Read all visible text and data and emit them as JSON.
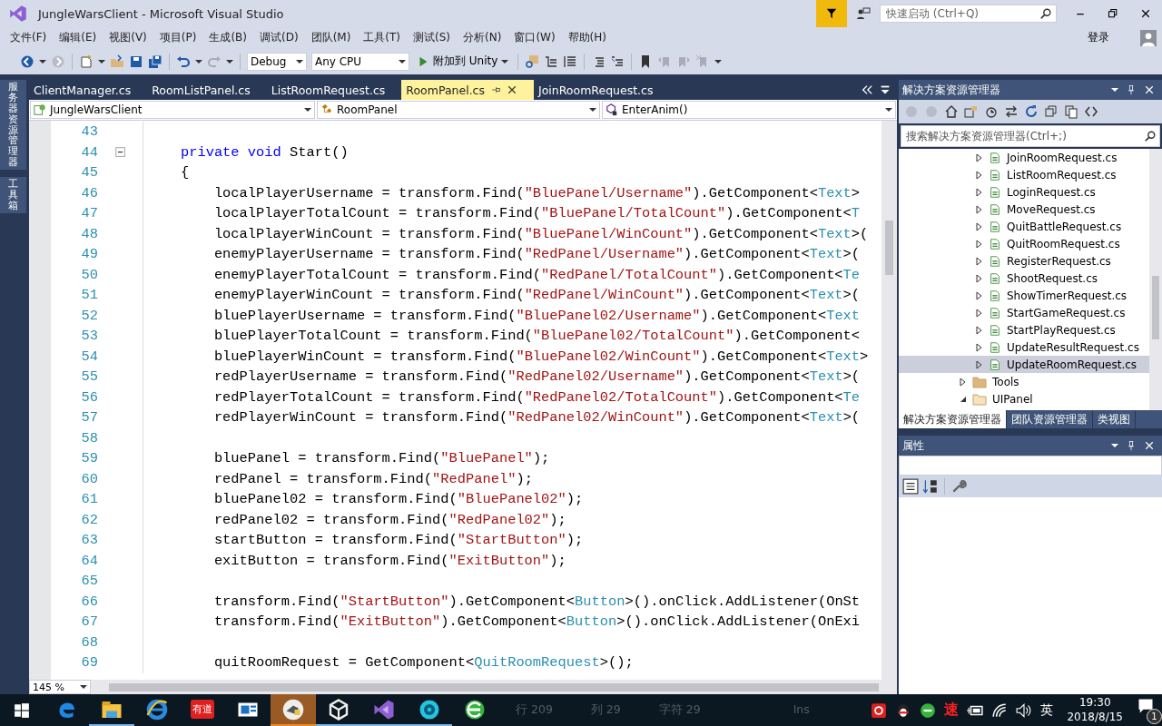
{
  "window": {
    "title": "JungleWarsClient - Microsoft Visual Studio",
    "quick_launch": {
      "placeholder": "快速启动 (Ctrl+Q)"
    }
  },
  "menu": [
    "文件(F)",
    "编辑(E)",
    "视图(V)",
    "项目(P)",
    "生成(B)",
    "调试(D)",
    "团队(M)",
    "工具(T)",
    "测试(S)",
    "分析(N)",
    "窗口(W)",
    "帮助(H)"
  ],
  "sign_in": "登录",
  "toolbar": {
    "configuration": "Debug",
    "platform": "Any CPU",
    "run": "附加到 Unity"
  },
  "side_tabs": [
    "服务器资源管理器",
    "工具箱"
  ],
  "editor_tabs": [
    {
      "label": "ClientManager.cs",
      "selected": false
    },
    {
      "label": "RoomListPanel.cs",
      "selected": false
    },
    {
      "label": "ListRoomRequest.cs",
      "selected": false
    },
    {
      "label": "RoomPanel.cs",
      "selected": true
    },
    {
      "label": "JoinRoomRequest.cs",
      "selected": false
    }
  ],
  "nav_bar": {
    "project": "JungleWarsClient",
    "type": "RoomPanel",
    "member": "EnterAnim()"
  },
  "code_lines": [
    {
      "number": "43"
    },
    {
      "number": "44",
      "collapsible": true,
      "tokens": [
        {
          "kind": "keyword",
          "text": "    private void"
        },
        {
          "kind": "plain",
          "text": " Start()"
        }
      ]
    },
    {
      "number": "45",
      "tokens": [
        {
          "kind": "plain",
          "text": "    {"
        }
      ]
    },
    {
      "number": "46",
      "tokens": [
        {
          "kind": "plain",
          "text": "        localPlayerUsername = transform.Find("
        },
        {
          "kind": "string",
          "text": "\"BluePanel/Username\""
        },
        {
          "kind": "plain",
          "text": ").GetComponent<"
        },
        {
          "kind": "type",
          "text": "Text"
        },
        {
          "kind": "plain",
          "text": ">"
        }
      ]
    },
    {
      "number": "47",
      "tokens": [
        {
          "kind": "plain",
          "text": "        localPlayerTotalCount = transform.Find("
        },
        {
          "kind": "string",
          "text": "\"BluePanel/TotalCount\""
        },
        {
          "kind": "plain",
          "text": ").GetComponent<"
        },
        {
          "kind": "type",
          "text": "T"
        }
      ]
    },
    {
      "number": "48",
      "tokens": [
        {
          "kind": "plain",
          "text": "        localPlayerWinCount = transform.Find("
        },
        {
          "kind": "string",
          "text": "\"BluePanel/WinCount\""
        },
        {
          "kind": "plain",
          "text": ").GetComponent<"
        },
        {
          "kind": "type",
          "text": "Text"
        },
        {
          "kind": "plain",
          "text": ">("
        }
      ]
    },
    {
      "number": "49",
      "tokens": [
        {
          "kind": "plain",
          "text": "        enemyPlayerUsername = transform.Find("
        },
        {
          "kind": "string",
          "text": "\"RedPanel/Username\""
        },
        {
          "kind": "plain",
          "text": ").GetComponent<"
        },
        {
          "kind": "type",
          "text": "Text"
        },
        {
          "kind": "plain",
          "text": ">("
        }
      ]
    },
    {
      "number": "50",
      "tokens": [
        {
          "kind": "plain",
          "text": "        enemyPlayerTotalCount = transform.Find("
        },
        {
          "kind": "string",
          "text": "\"RedPanel/TotalCount\""
        },
        {
          "kind": "plain",
          "text": ").GetComponent<"
        },
        {
          "kind": "type",
          "text": "Te"
        }
      ]
    },
    {
      "number": "51",
      "tokens": [
        {
          "kind": "plain",
          "text": "        enemyPlayerWinCount = transform.Find("
        },
        {
          "kind": "string",
          "text": "\"RedPanel/WinCount\""
        },
        {
          "kind": "plain",
          "text": ").GetComponent<"
        },
        {
          "kind": "type",
          "text": "Text"
        },
        {
          "kind": "plain",
          "text": ">("
        }
      ]
    },
    {
      "number": "52",
      "tokens": [
        {
          "kind": "plain",
          "text": "        bluePlayerUsername = transform.Find("
        },
        {
          "kind": "string",
          "text": "\"BluePanel02/Username\""
        },
        {
          "kind": "plain",
          "text": ").GetComponent<"
        },
        {
          "kind": "type",
          "text": "Text"
        }
      ]
    },
    {
      "number": "53",
      "tokens": [
        {
          "kind": "plain",
          "text": "        bluePlayerTotalCount = transform.Find("
        },
        {
          "kind": "string",
          "text": "\"BluePanel02/TotalCount\""
        },
        {
          "kind": "plain",
          "text": ").GetComponent<"
        }
      ]
    },
    {
      "number": "54",
      "tokens": [
        {
          "kind": "plain",
          "text": "        bluePlayerWinCount = transform.Find("
        },
        {
          "kind": "string",
          "text": "\"BluePanel02/WinCount\""
        },
        {
          "kind": "plain",
          "text": ").GetComponent<"
        },
        {
          "kind": "type",
          "text": "Text"
        },
        {
          "kind": "plain",
          "text": ">"
        }
      ]
    },
    {
      "number": "55",
      "tokens": [
        {
          "kind": "plain",
          "text": "        redPlayerUsername = transform.Find("
        },
        {
          "kind": "string",
          "text": "\"RedPanel02/Username\""
        },
        {
          "kind": "plain",
          "text": ").GetComponent<"
        },
        {
          "kind": "type",
          "text": "Text"
        },
        {
          "kind": "plain",
          "text": ">("
        }
      ]
    },
    {
      "number": "56",
      "tokens": [
        {
          "kind": "plain",
          "text": "        redPlayerTotalCount = transform.Find("
        },
        {
          "kind": "string",
          "text": "\"RedPanel02/TotalCount\""
        },
        {
          "kind": "plain",
          "text": ").GetComponent<"
        },
        {
          "kind": "type",
          "text": "Te"
        }
      ]
    },
    {
      "number": "57",
      "tokens": [
        {
          "kind": "plain",
          "text": "        redPlayerWinCount = transform.Find("
        },
        {
          "kind": "string",
          "text": "\"RedPanel02/WinCount\""
        },
        {
          "kind": "plain",
          "text": ").GetComponent<"
        },
        {
          "kind": "type",
          "text": "Text"
        },
        {
          "kind": "plain",
          "text": ">("
        }
      ]
    },
    {
      "number": "58"
    },
    {
      "number": "59",
      "tokens": [
        {
          "kind": "plain",
          "text": "        bluePanel = transform.Find("
        },
        {
          "kind": "string",
          "text": "\"BluePanel\""
        },
        {
          "kind": "plain",
          "text": ");"
        }
      ]
    },
    {
      "number": "60",
      "tokens": [
        {
          "kind": "plain",
          "text": "        redPanel = transform.Find("
        },
        {
          "kind": "string",
          "text": "\"RedPanel\""
        },
        {
          "kind": "plain",
          "text": ");"
        }
      ]
    },
    {
      "number": "61",
      "tokens": [
        {
          "kind": "plain",
          "text": "        bluePanel02 = transform.Find("
        },
        {
          "kind": "string",
          "text": "\"BluePanel02\""
        },
        {
          "kind": "plain",
          "text": ");"
        }
      ]
    },
    {
      "number": "62",
      "tokens": [
        {
          "kind": "plain",
          "text": "        redPanel02 = transform.Find("
        },
        {
          "kind": "string",
          "text": "\"RedPanel02\""
        },
        {
          "kind": "plain",
          "text": ");"
        }
      ]
    },
    {
      "number": "63",
      "tokens": [
        {
          "kind": "plain",
          "text": "        startButton = transform.Find("
        },
        {
          "kind": "string",
          "text": "\"StartButton\""
        },
        {
          "kind": "plain",
          "text": ");"
        }
      ]
    },
    {
      "number": "64",
      "tokens": [
        {
          "kind": "plain",
          "text": "        exitButton = transform.Find("
        },
        {
          "kind": "string",
          "text": "\"ExitButton\""
        },
        {
          "kind": "plain",
          "text": ");"
        }
      ]
    },
    {
      "number": "65"
    },
    {
      "number": "66",
      "tokens": [
        {
          "kind": "plain",
          "text": "        transform.Find("
        },
        {
          "kind": "string",
          "text": "\"StartButton\""
        },
        {
          "kind": "plain",
          "text": ").GetComponent<"
        },
        {
          "kind": "type",
          "text": "Button"
        },
        {
          "kind": "plain",
          "text": ">().onClick.AddListener(OnSt"
        }
      ]
    },
    {
      "number": "67",
      "tokens": [
        {
          "kind": "plain",
          "text": "        transform.Find("
        },
        {
          "kind": "string",
          "text": "\"ExitButton\""
        },
        {
          "kind": "plain",
          "text": ").GetComponent<"
        },
        {
          "kind": "type",
          "text": "Button"
        },
        {
          "kind": "plain",
          "text": ">().onClick.AddListener(OnExi"
        }
      ]
    },
    {
      "number": "68"
    },
    {
      "number": "69",
      "tokens": [
        {
          "kind": "plain",
          "text": "        quitRoomRequest = GetComponent<"
        },
        {
          "kind": "type",
          "text": "QuitRoomRequest"
        },
        {
          "kind": "plain",
          "text": ">();"
        }
      ]
    }
  ],
  "zoom": "145 %",
  "solution_explorer": {
    "title": "解决方案资源管理器",
    "search": {
      "placeholder": "搜索解决方案资源管理器(Ctrl+;)"
    },
    "tree": [
      {
        "children": [
          {
            "label": "JoinRoomRequest.cs",
            "kind": "csharp",
            "expanded": false,
            "selected": false
          },
          {
            "label": "ListRoomRequest.cs",
            "kind": "csharp",
            "expanded": false,
            "selected": false
          },
          {
            "label": "LoginRequest.cs",
            "kind": "csharp",
            "expanded": false,
            "selected": false
          },
          {
            "label": "MoveRequest.cs",
            "kind": "csharp",
            "expanded": false,
            "selected": false
          },
          {
            "label": "QuitBattleRequest.cs",
            "kind": "csharp",
            "expanded": false,
            "selected": false
          },
          {
            "label": "QuitRoomRequest.cs",
            "kind": "csharp",
            "expanded": false,
            "selected": false
          },
          {
            "label": "RegisterRequest.cs",
            "kind": "csharp",
            "expanded": false,
            "selected": false
          },
          {
            "label": "ShootRequest.cs",
            "kind": "csharp",
            "expanded": false,
            "selected": false
          },
          {
            "label": "ShowTimerRequest.cs",
            "kind": "csharp",
            "expanded": false,
            "selected": false
          },
          {
            "label": "StartGameRequest.cs",
            "kind": "csharp",
            "expanded": false,
            "selected": false
          },
          {
            "label": "StartPlayRequest.cs",
            "kind": "csharp",
            "expanded": false,
            "selected": false
          },
          {
            "label": "UpdateResultRequest.cs",
            "kind": "csharp",
            "expanded": false,
            "selected": false
          },
          {
            "label": "UpdateRoomRequest.cs",
            "kind": "csharp",
            "expanded": false,
            "selected": true
          }
        ]
      },
      {
        "label": "Tools",
        "kind": "folder",
        "expanded": false,
        "selected": false
      },
      {
        "label": "UIPanel",
        "kind": "folder",
        "expanded": true,
        "selected": false
      }
    ],
    "tabs": [
      {
        "label": "解决方案资源管理器",
        "selected": true
      },
      {
        "label": "团队资源管理器",
        "selected": false
      },
      {
        "label": "类视图",
        "selected": false
      }
    ]
  },
  "properties": {
    "title": "属性"
  },
  "status_bar": [
    "行 209",
    "列 29",
    "字符 29",
    "Ins"
  ],
  "taskbar": {
    "apps": [
      {
        "kind": "edge",
        "running": false,
        "selected": false
      },
      {
        "kind": "explorer",
        "running": true,
        "selected": false
      },
      {
        "kind": "ie",
        "running": false,
        "selected": false
      },
      {
        "kind": "dictionary",
        "label": "有道",
        "running": false,
        "selected": false
      },
      {
        "kind": "window",
        "running": false,
        "selected": false
      },
      {
        "kind": "bird",
        "running": true,
        "selected": true
      },
      {
        "kind": "unity",
        "running": true,
        "selected": false
      },
      {
        "kind": "vs",
        "running": true,
        "selected": false
      },
      {
        "kind": "video",
        "running": true,
        "selected": false
      },
      {
        "kind": "browser",
        "running": false,
        "selected": false
      }
    ],
    "speed_label": "速",
    "input_method": "英",
    "time": "19:30",
    "date": "2018/8/15",
    "notifications": "1"
  }
}
